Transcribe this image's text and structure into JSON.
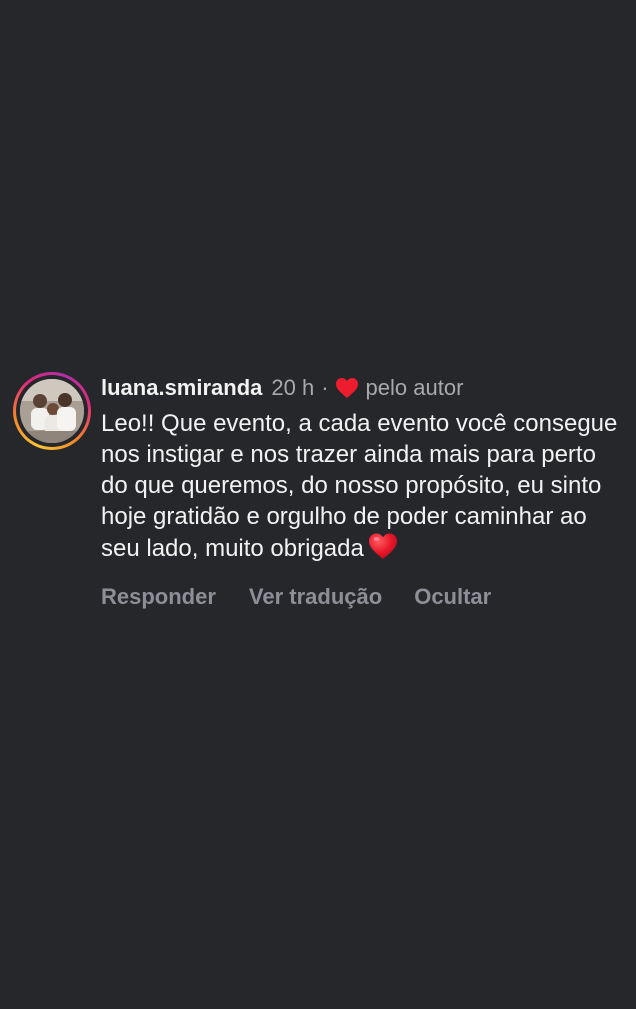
{
  "comment": {
    "username": "luana.smiranda",
    "time": "20 h",
    "separator": "·",
    "liked_by_author": "pelo autor",
    "text": "Leo!! Que evento, a cada evento você consegue nos instigar e nos trazer ainda mais para perto do que queremos, do nosso propósito, eu sinto hoje gratidão e orgulho de poder caminhar ao seu lado, muito obrigada",
    "emoji": "red-heart",
    "actions": {
      "reply": "Responder",
      "translate": "Ver tradução",
      "hide": "Ocultar"
    }
  },
  "colors": {
    "background": "#26272b",
    "primary_text": "#f2f2f2",
    "secondary_text": "#a8a8ad",
    "action_text": "#8e8f96",
    "heart": "#ed1c2e"
  }
}
